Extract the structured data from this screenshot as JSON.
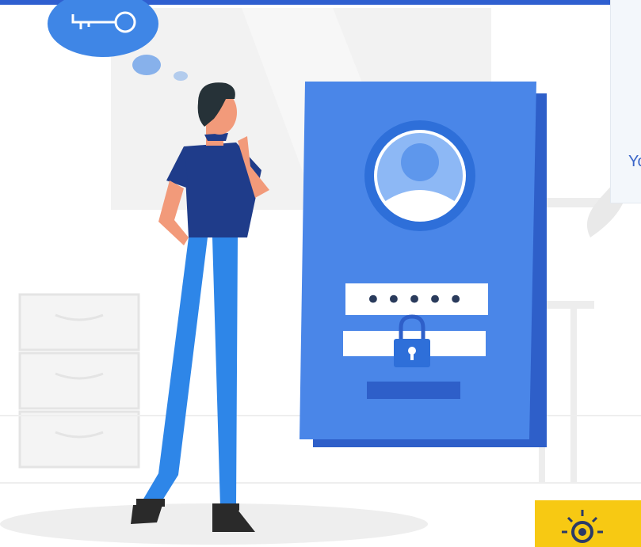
{
  "header": {
    "accent_color": "#2f5fd0"
  },
  "illustration": {
    "thought_bubble_icon": "key-icon",
    "login_card": {
      "avatar_icon": "user-avatar-icon",
      "password_mask": "•••••",
      "lock_icon": "padlock-icon"
    }
  },
  "side_panel": {
    "text": "Yo"
  },
  "help_button": {
    "icon": "lightbulb-gear-icon",
    "color": "#f7c913"
  }
}
